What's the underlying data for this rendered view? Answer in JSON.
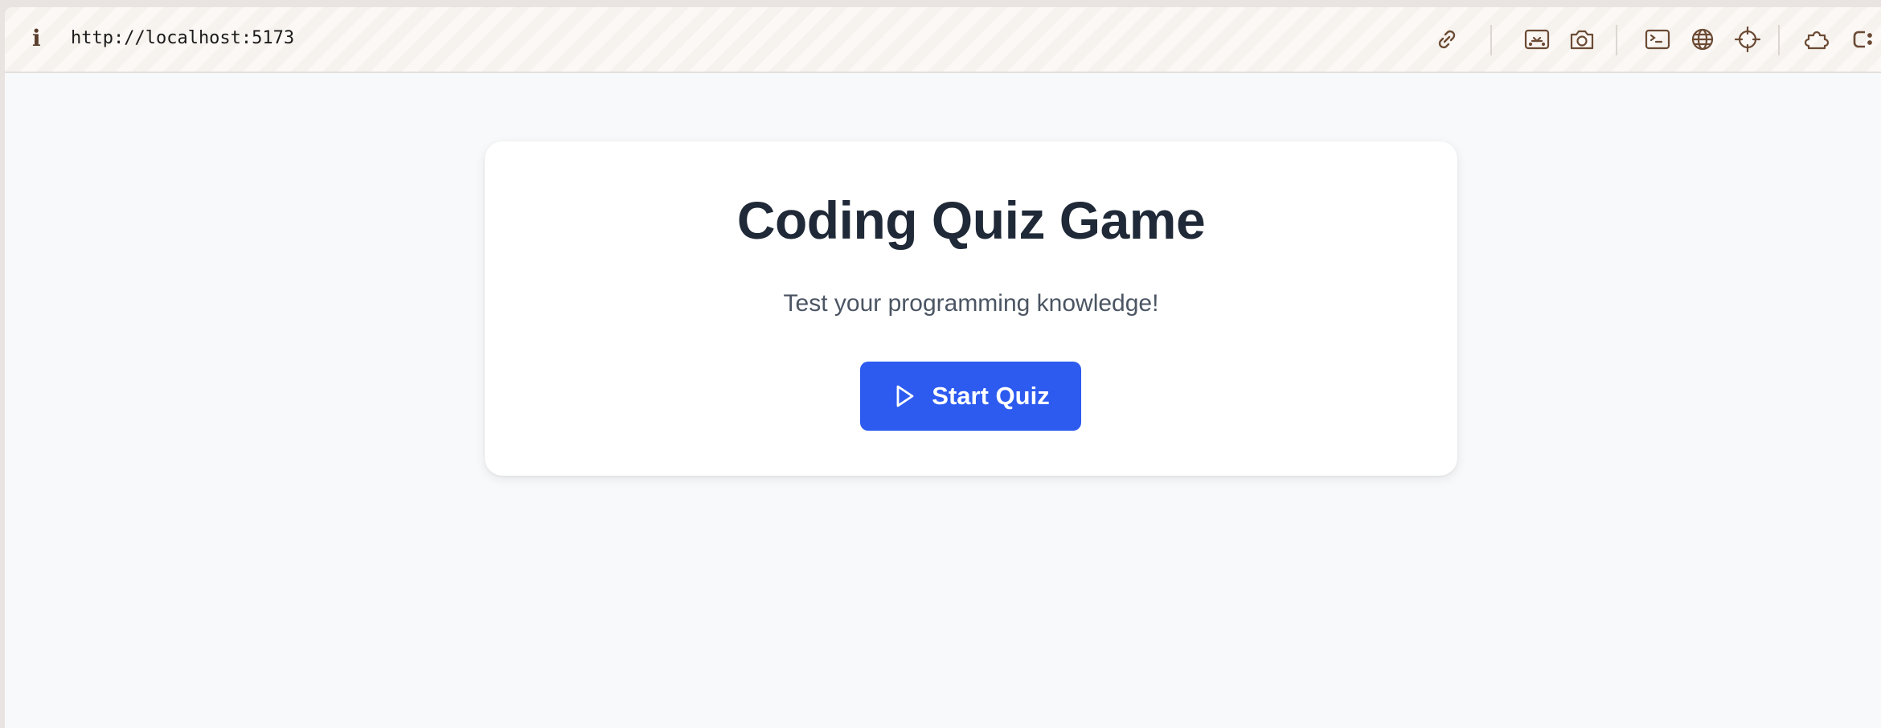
{
  "browser": {
    "url": "http://localhost:5173",
    "info_glyph": "i",
    "icons": [
      "link-icon",
      "preview-icon",
      "camera-icon",
      "terminal-icon",
      "globe-icon",
      "crosshair-icon",
      "extension-icon",
      "more-icon"
    ]
  },
  "quiz": {
    "title": "Coding Quiz Game",
    "subtitle": "Test your programming knowledge!",
    "start_label": "Start Quiz"
  },
  "colors": {
    "primary": "#2d5bf0",
    "title": "#1f2937",
    "subtitle": "#4b5563",
    "icon": "#6b4a34"
  }
}
